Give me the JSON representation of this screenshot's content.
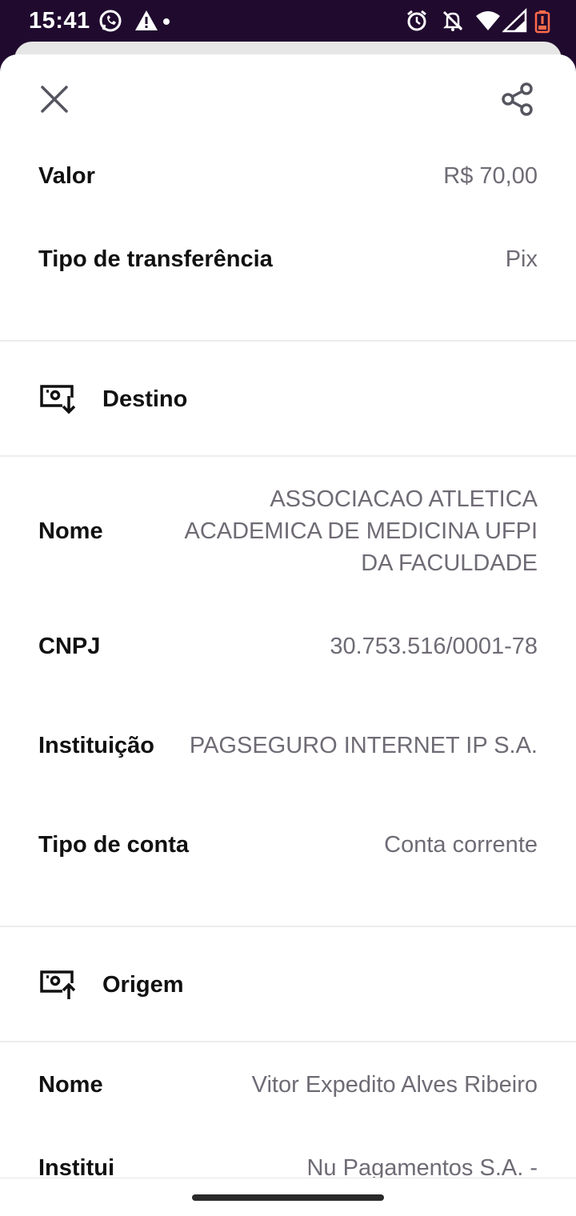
{
  "status_bar": {
    "time": "15:41",
    "left_icons": [
      "whatsapp-icon",
      "warning-icon",
      "dot-icon"
    ],
    "right_icons": [
      "alarm-icon",
      "notifications-off-icon",
      "wifi-icon",
      "signal-icon",
      "battery-low-icon"
    ]
  },
  "header": {
    "close_icon": "close-icon",
    "share_icon": "share-icon"
  },
  "summary": {
    "valor_label": "Valor",
    "valor_value": "R$ 70,00",
    "tipo_label": "Tipo de transferência",
    "tipo_value": "Pix"
  },
  "destino": {
    "title": "Destino",
    "icon": "money-receive-icon",
    "nome_label": "Nome",
    "nome_value": "ASSOCIACAO ATLETICA ACADEMICA DE MEDICINA UFPI DA FACULDADE",
    "cnpj_label": "CNPJ",
    "cnpj_value": "30.753.516/0001-78",
    "instituicao_label": "Instituição",
    "instituicao_value": "PAGSEGURO INTERNET IP S.A.",
    "tipo_conta_label": "Tipo de conta",
    "tipo_conta_value": "Conta corrente"
  },
  "origem": {
    "title": "Origem",
    "icon": "money-send-icon",
    "nome_label": "Nome",
    "nome_value": "Vitor Expedito Alves Ribeiro",
    "instituicao_label": "Instituição",
    "instituicao_value": "Nu Pagamentos S.A. - Instituição de Pagamento"
  },
  "colors": {
    "status_bar_bg": "#200a2e",
    "label_text": "#111111",
    "value_text": "#6f6b75",
    "divider": "#ececec"
  }
}
